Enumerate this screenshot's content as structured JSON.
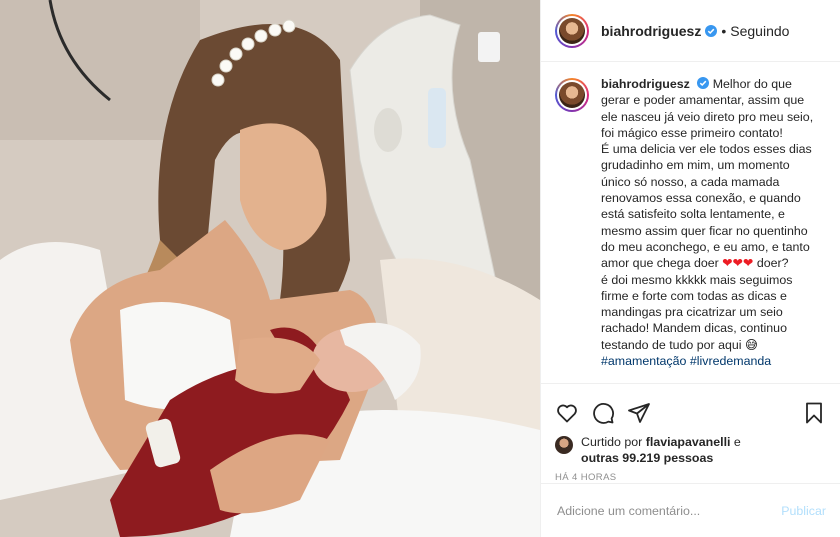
{
  "post": {
    "username": "biahrodriguesz",
    "follow_status": "Seguindo",
    "more_label": "•••",
    "photo_alt": "Foto"
  },
  "caption": {
    "username": "biahrodriguesz",
    "lines": [
      "Melhor do que",
      "gerar e poder amamentar, assim que",
      "ele nasceu já veio direto pro meu seio,",
      "foi mágico esse primeiro contato!",
      "É uma delicia ver ele todos esses dias",
      "grudadinho em mim, um momento",
      "único só nosso, a cada mamada",
      "renovamos essa conexão, e quando",
      "está satisfeito solta lentamente, e",
      "mesmo assim quer ficar no quentinho",
      "do meu aconchego, e eu amo, e tanto"
    ],
    "line_12_before": "amor que chega doer",
    "hearts": "❤❤❤",
    "line_12_after": "doer?",
    "lines_after": [
      "é doi mesmo kkkkk mais seguimos",
      "firme e forte com todas as dicas e",
      "mandingas pra cicatrizar um seio",
      "rachado! Mandem dicas, continuo"
    ],
    "last_line": "testando de tudo por aqui",
    "emoji": "😅",
    "hashtags": [
      "#amamentação",
      "#livredemanda"
    ]
  },
  "likes": {
    "prefix": "Curtido por",
    "user": "flaviapavanelli",
    "conj": "e",
    "others": "outras 99.219 pessoas"
  },
  "timestamp": "HÁ 4 HORAS",
  "comment": {
    "placeholder": "Adicione um comentário...",
    "publish": "Publicar"
  },
  "colors": {
    "brand_blue": "#3897f0",
    "hashtag": "#00376b",
    "publish_disabled": "#b2dffc",
    "muted": "#8e8e8e"
  },
  "icons": [
    "verified-badge-icon",
    "heart-icon",
    "comment-icon",
    "share-icon",
    "bookmark-icon"
  ]
}
